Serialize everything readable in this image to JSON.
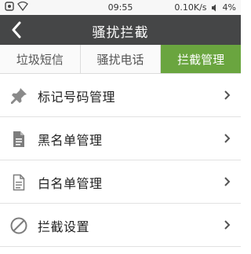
{
  "status_bar": {
    "time": "09:55",
    "network_speed": "0.10K/s",
    "battery": "4%"
  },
  "header": {
    "title": "骚扰拦截",
    "back_icon": "back-arrow-icon"
  },
  "tabs": [
    {
      "label": "垃圾短信",
      "active": false
    },
    {
      "label": "骚扰电话",
      "active": false
    },
    {
      "label": "拦截管理",
      "active": true
    }
  ],
  "menu": {
    "items": [
      {
        "label": "标记号码管理",
        "icon": "pushpin-icon"
      },
      {
        "label": "黑名单管理",
        "icon": "document-filled-icon"
      },
      {
        "label": "白名单管理",
        "icon": "document-outline-icon"
      },
      {
        "label": "拦截设置",
        "icon": "block-icon"
      }
    ]
  },
  "colors": {
    "header_bg": "#454647",
    "tab_active_bg": "#6aa53f"
  }
}
